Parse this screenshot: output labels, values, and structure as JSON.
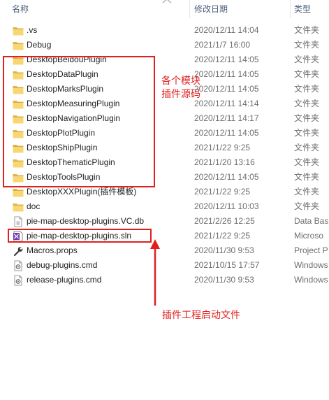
{
  "columns": {
    "name": "名称",
    "date": "修改日期",
    "type": "类型"
  },
  "colors": {
    "folder": "#e8c05a",
    "annotation": "#e0201f",
    "header_text": "#4c607a"
  },
  "files": [
    {
      "name": ".vs",
      "date": "2020/12/11 14:04",
      "type": "文件夹",
      "icon": "folder-icon"
    },
    {
      "name": "Debug",
      "date": "2021/1/7 16:00",
      "type": "文件夹",
      "icon": "folder-icon"
    },
    {
      "name": "DesktopBeidouPlugin",
      "date": "2020/12/11 14:05",
      "type": "文件夹",
      "icon": "folder-icon"
    },
    {
      "name": "DesktopDataPlugin",
      "date": "2020/12/11 14:05",
      "type": "文件夹",
      "icon": "folder-icon"
    },
    {
      "name": "DesktopMarksPlugin",
      "date": "2020/12/11 14:05",
      "type": "文件夹",
      "icon": "folder-icon"
    },
    {
      "name": "DesktopMeasuringPlugin",
      "date": "2020/12/11 14:14",
      "type": "文件夹",
      "icon": "folder-icon"
    },
    {
      "name": "DesktopNavigationPlugin",
      "date": "2020/12/11 14:17",
      "type": "文件夹",
      "icon": "folder-icon"
    },
    {
      "name": "DesktopPlotPlugin",
      "date": "2020/12/11 14:05",
      "type": "文件夹",
      "icon": "folder-icon"
    },
    {
      "name": "DesktopShipPlugin",
      "date": "2021/1/22 9:25",
      "type": "文件夹",
      "icon": "folder-icon"
    },
    {
      "name": "DesktopThematicPlugin",
      "date": "2021/1/20 13:16",
      "type": "文件夹",
      "icon": "folder-icon"
    },
    {
      "name": "DesktopToolsPlugin",
      "date": "2020/12/11 14:05",
      "type": "文件夹",
      "icon": "folder-icon"
    },
    {
      "name": "DesktopXXXPlugin(插件模板)",
      "date": "2021/1/22 9:25",
      "type": "文件夹",
      "icon": "folder-icon"
    },
    {
      "name": "doc",
      "date": "2020/12/11 10:03",
      "type": "文件夹",
      "icon": "folder-icon"
    },
    {
      "name": "pie-map-desktop-plugins.VC.db",
      "date": "2021/2/26 12:25",
      "type": "Data Bas",
      "icon": "db-file-icon"
    },
    {
      "name": "pie-map-desktop-plugins.sln",
      "date": "2021/1/22 9:25",
      "type": "Microso",
      "icon": "visual-studio-sln-icon"
    },
    {
      "name": "Macros.props",
      "date": "2020/11/30 9:53",
      "type": "Project P",
      "icon": "wrench-file-icon"
    },
    {
      "name": "debug-plugins.cmd",
      "date": "2021/10/15 17:57",
      "type": "Windows",
      "icon": "cmd-file-icon"
    },
    {
      "name": "release-plugins.cmd",
      "date": "2020/11/30 9:53",
      "type": "Windows",
      "icon": "cmd-file-icon"
    }
  ],
  "annotations": {
    "modules_line1": "各个模块",
    "modules_line2": "插件源码",
    "startup": "插件工程启动文件"
  }
}
